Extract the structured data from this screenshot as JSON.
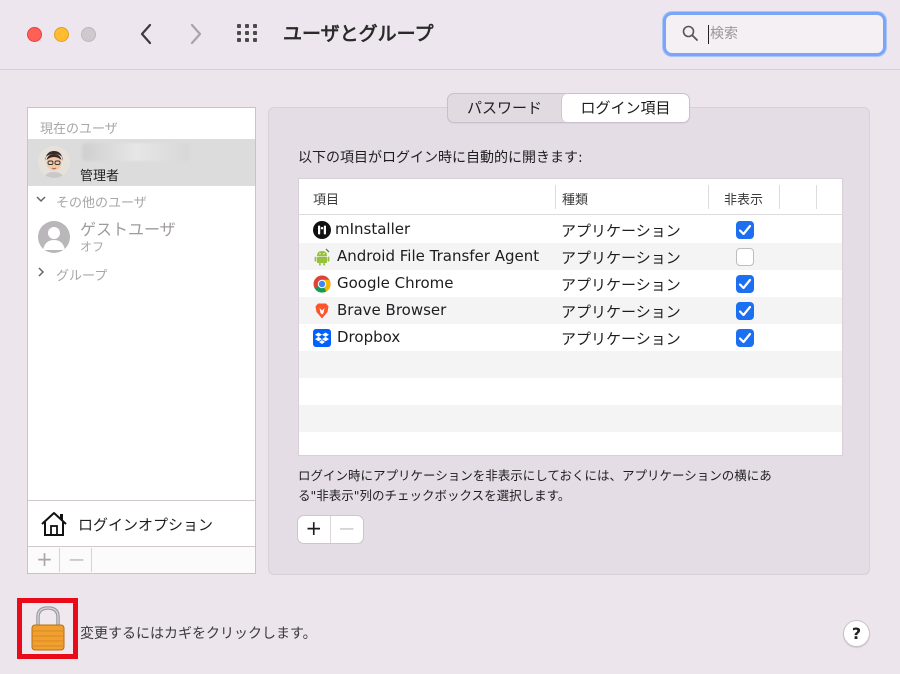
{
  "window": {
    "title": "ユーザとグループ",
    "search_placeholder": "検索"
  },
  "sidebar": {
    "current_users_label": "現在のユーザ",
    "current_user": {
      "name": "",
      "role": "管理者"
    },
    "other_users_label": "その他のユーザ",
    "guest_user": {
      "name": "ゲストユーザ",
      "status": "オフ"
    },
    "groups_label": "グループ",
    "login_options_label": "ログインオプション",
    "add_symbol": "+",
    "remove_symbol": "—"
  },
  "tabs": [
    {
      "label": "パスワード",
      "active": false
    },
    {
      "label": "ログイン項目",
      "active": true
    }
  ],
  "main": {
    "description_top": "以下の項目がログイン時に自動的に開きます:",
    "columns": [
      "項目",
      "種類",
      "非表示"
    ],
    "rows": [
      {
        "name": "mInstaller",
        "kind": "アプリケーション",
        "hidden": true,
        "icon": "minstaller-icon"
      },
      {
        "name": "Android File Transfer Agent",
        "kind": "アプリケーション",
        "hidden": false,
        "icon": "android-icon"
      },
      {
        "name": "Google Chrome",
        "kind": "アプリケーション",
        "hidden": true,
        "icon": "chrome-icon"
      },
      {
        "name": "Brave Browser",
        "kind": "アプリケーション",
        "hidden": true,
        "icon": "brave-icon"
      },
      {
        "name": "Dropbox",
        "kind": "アプリケーション",
        "hidden": true,
        "icon": "dropbox-icon"
      }
    ],
    "description_bottom_line1": "ログイン時にアプリケーションを非表示にしておくには、アプリケーションの横にあ",
    "description_bottom_line2": "る\"非表示\"列のチェックボックスを選択します。",
    "add_symbol": "+",
    "remove_symbol": "—"
  },
  "footer": {
    "lock_text": "変更するにはカギをクリックします。",
    "help_symbol": "?"
  },
  "colors": {
    "accent": "#1d6ff2",
    "lock_highlight": "#ea0b1a",
    "search_focus": "#7ba6f5"
  }
}
